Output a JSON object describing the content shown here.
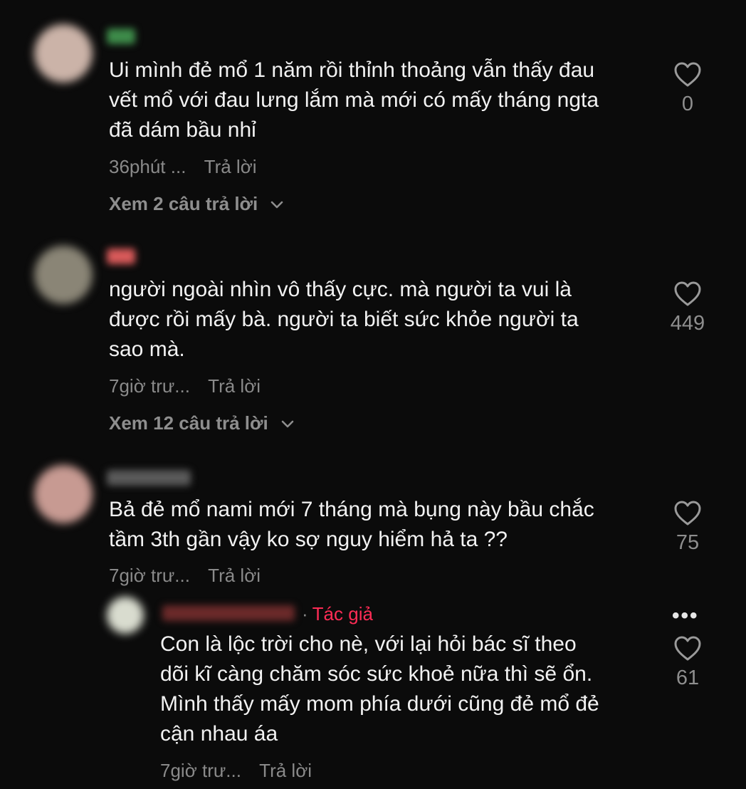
{
  "comments": [
    {
      "lines": [
        "Ui mình đẻ mổ 1 năm rồi thỉnh thoảng vẫn thấy đau",
        "vết mổ với đau lưng lắm mà mới có mấy tháng ngta",
        "đã dám bầu nhỉ"
      ],
      "time": "36phút ...",
      "reply_label": "Trả lời",
      "likes": "0",
      "view_replies": "Xem 2 câu trả lời",
      "avatar_color": "#cbb3a8",
      "username_color": "#3e8c4a"
    },
    {
      "lines": [
        "người ngoài nhìn vô thấy cực. mà người ta vui là",
        "được rồi mấy bà. người ta biết sức khỏe người ta",
        "sao mà."
      ],
      "time": "7giờ trư...",
      "reply_label": "Trả lời",
      "likes": "449",
      "view_replies": "Xem 12 câu trả lời",
      "avatar_color": "#8a8576",
      "username_color": "#d85a5a"
    },
    {
      "lines": [
        "Bả đẻ mổ nami mới 7 tháng mà bụng này bầu chắc",
        "tầm 3th gần vậy ko sợ nguy hiểm hả ta ??"
      ],
      "time": "7giờ trư...",
      "reply_label": "Trả lời",
      "likes": "75",
      "avatar_color": "#c79a92",
      "username_color": "#5a5a5a"
    }
  ],
  "reply": {
    "author_label": "Tác giả",
    "more_label": "•••",
    "lines": [
      "Con là lộc trời cho nè, với lại hỏi bác sĩ theo",
      "dõi kĩ càng chăm sóc sức khoẻ nữa thì sẽ ổn.",
      "Mình thấy mấy mom phía dưới cũng đẻ mổ đẻ",
      "cận nhau áa"
    ],
    "time": "7giờ trư...",
    "reply_label": "Trả lời",
    "likes": "61",
    "avatar_color": "#d9dccf",
    "username_color": "#6b2a2a"
  },
  "colors": {
    "background": "#0b0b0b",
    "text": "#f2f2f2",
    "secondary": "#8a8a8a",
    "author_accent": "#fe2c55"
  }
}
